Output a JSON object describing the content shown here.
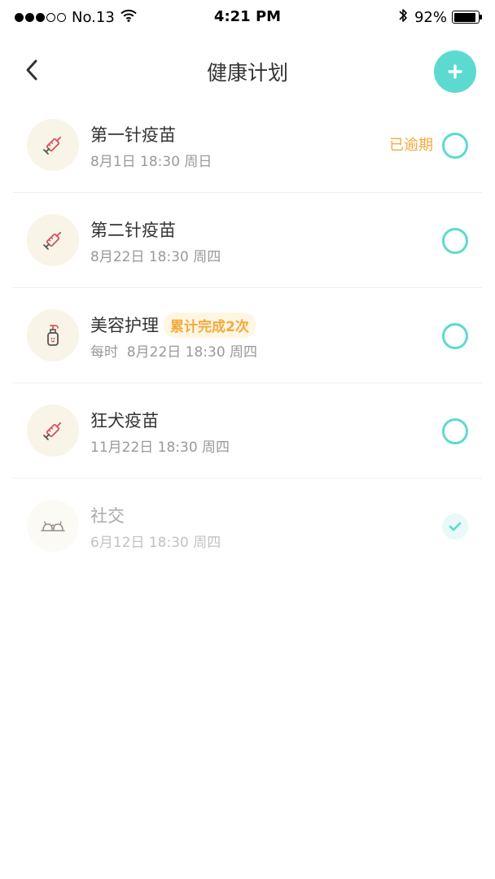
{
  "status_bar": {
    "carrier": "No.13",
    "time": "4:21 PM",
    "battery": "92%"
  },
  "nav": {
    "title": "健康计划",
    "back_icon": "chevron-left-icon",
    "add_icon": "plus-icon"
  },
  "colors": {
    "accent": "#5ddad0",
    "warning": "#f4a93c",
    "icon_bg": "#f8f4e8"
  },
  "plans": [
    {
      "title": "第一针疫苗",
      "subtitle": "8月1日 18:30 周日",
      "status": "已逾期",
      "badge": "",
      "icon": "syringe-icon",
      "completed": false
    },
    {
      "title": "第二针疫苗",
      "subtitle": "8月22日 18:30 周四",
      "status": "",
      "badge": "",
      "icon": "syringe-icon",
      "completed": false
    },
    {
      "title": "美容护理",
      "subtitle": "每时  8月22日 18:30 周四",
      "status": "",
      "badge": "累计完成2次",
      "icon": "shampoo-bottle-icon",
      "completed": false
    },
    {
      "title": "狂犬疫苗",
      "subtitle": "11月22日 18:30 周四",
      "status": "",
      "badge": "",
      "icon": "syringe-icon",
      "completed": false
    },
    {
      "title": "社交",
      "subtitle": "6月12日 18:30 周四",
      "status": "",
      "badge": "",
      "icon": "pets-social-icon",
      "completed": true
    }
  ]
}
